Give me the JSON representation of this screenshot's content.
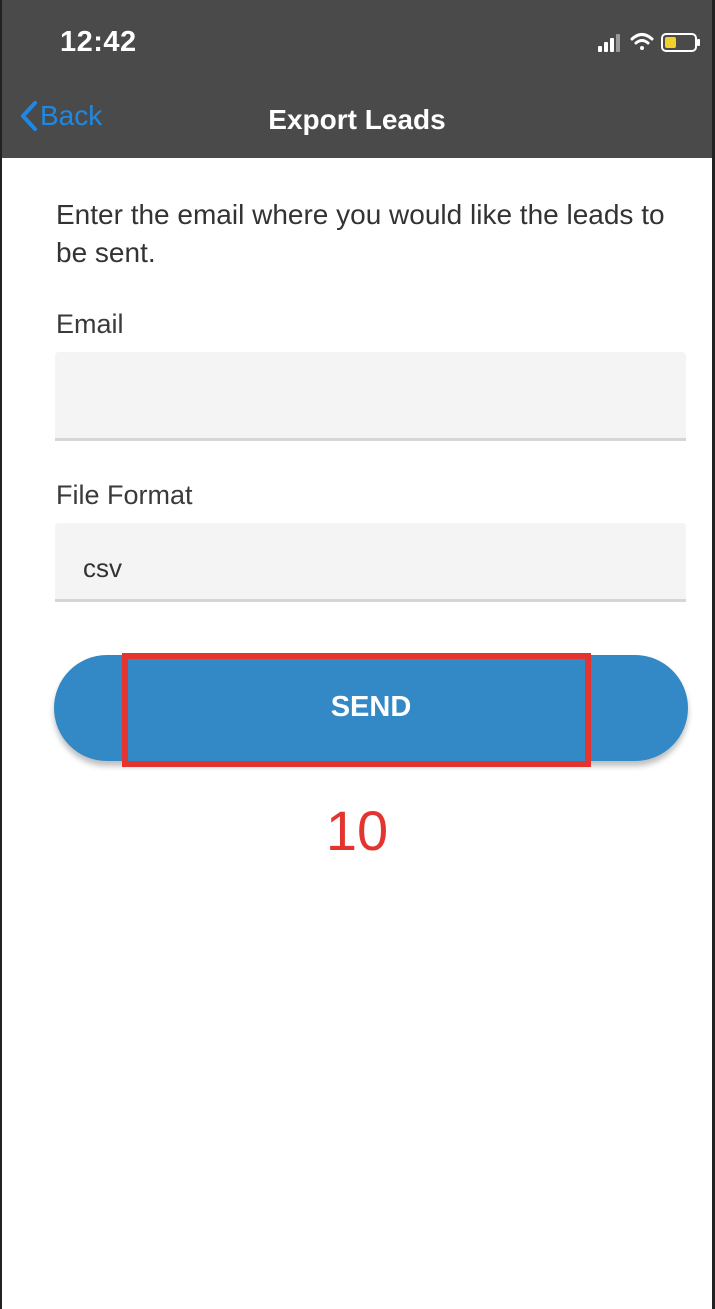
{
  "status_bar": {
    "time": "12:42",
    "icons": [
      "signal-icon",
      "wifi-icon",
      "battery-icon"
    ],
    "battery_color": "#f1d02c"
  },
  "nav": {
    "back_label": "Back",
    "title": "Export Leads",
    "accent_color": "#1e88e5"
  },
  "form": {
    "intro": "Enter the email where you would like the leads to be sent.",
    "email_label": "Email",
    "email_value": "",
    "format_label": "File Format",
    "format_value": "csv",
    "send_label": "SEND"
  },
  "annotation": {
    "step": "10",
    "color": "#e3342f"
  }
}
